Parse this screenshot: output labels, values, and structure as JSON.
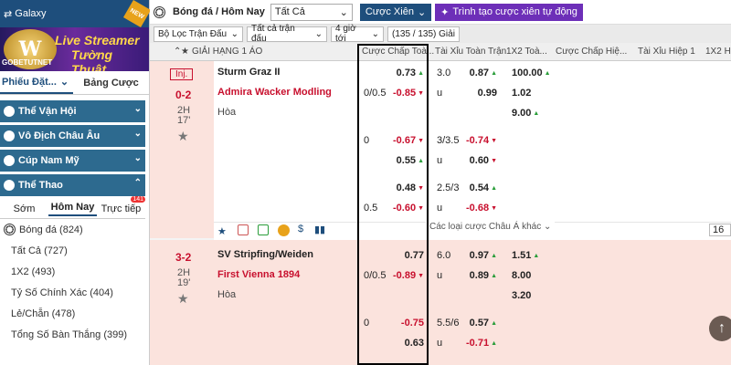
{
  "sidebar": {
    "galaxy": "Galaxy",
    "new_badge": "NEW",
    "banner_line1": "Live Streamer",
    "banner_line2": "Tường Thuật",
    "banner_brand": "GOBETUTNET",
    "tab_phieu": "Phiếu Đặt...",
    "tab_bang": "Bảng Cược",
    "menu": [
      "Thể Vận Hội",
      "Vô Địch Châu Âu",
      "Cúp Nam Mỹ",
      "Thể Thao"
    ],
    "subtabs": [
      "Sớm",
      "Hôm Nay",
      "Trực tiếp"
    ],
    "live_count": "141",
    "sport": "Bóng đá (824)",
    "items": [
      "Tất Cả (727)",
      "1X2 (493)",
      "Tỷ Số Chính Xác (404)",
      "Lẻ/Chẵn (478)",
      "Tổng Số Bàn Thắng (399)"
    ]
  },
  "topbar": {
    "title": "Bóng đá / Hôm Nay",
    "select": "Tất Cả",
    "cuoc_xien": "Cược Xiên",
    "tao_cuoc": "Trình tạo cược xiên tự động"
  },
  "filters": {
    "loc": "Bộ Lọc Trận Đấu",
    "tat_ca": "Tất cả trận đấu",
    "gio": "4 giờ tới",
    "count": "(135 / 135) Giải"
  },
  "header": {
    "league": "GIẢI HẠNG 1 ÁO",
    "c1": "Cược Chấp Toà...",
    "c2": "Tài Xỉu Toàn Trận",
    "c3": "1X2 Toà...",
    "c4": "Cược Chấp Hiệ...",
    "c5": "Tài Xỉu Hiệp 1",
    "c6": "1X2 Hi"
  },
  "match1": {
    "status": "Inj.",
    "score": "0-2",
    "period": "2H",
    "minute": "17'",
    "home": "Sturm Graz II",
    "away": "Admira Wacker Modling",
    "draw": "Hòa"
  },
  "match2": {
    "score": "3-2",
    "period": "2H",
    "minute": "19'",
    "home": "SV Stripfing/Weiden",
    "away": "First Vienna 1894",
    "draw": "Hòa"
  },
  "m1_rows": [
    {
      "hcap": "",
      "hval": "0.73",
      "ou": "3.0",
      "ouv": "0.87",
      "x12": "100.00"
    },
    {
      "hcap": "0/0.5",
      "hval": "-0.85",
      "ou": "u",
      "ouv": "0.99",
      "x12": "1.02"
    },
    {
      "hcap": "",
      "hval": "",
      "ou": "",
      "ouv": "",
      "x12": "9.00"
    },
    {
      "hcap": "0",
      "hval": "-0.67",
      "ou": "3/3.5",
      "ouv": "-0.74",
      "x12": ""
    },
    {
      "hcap": "",
      "hval": "0.55",
      "ou": "u",
      "ouv": "0.60",
      "x12": ""
    },
    {
      "hcap": "",
      "hval": "0.48",
      "ou": "2.5/3",
      "ouv": "0.54",
      "x12": ""
    },
    {
      "hcap": "0.5",
      "hval": "-0.60",
      "ou": "u",
      "ouv": "-0.68",
      "x12": ""
    }
  ],
  "m2_rows": [
    {
      "hcap": "",
      "hval": "0.77",
      "ou": "6.0",
      "ouv": "0.97",
      "x12": "1.51"
    },
    {
      "hcap": "0/0.5",
      "hval": "-0.89",
      "ou": "u",
      "ouv": "0.89",
      "x12": "8.00"
    },
    {
      "hcap": "",
      "hval": "",
      "ou": "",
      "ouv": "",
      "x12": "3.20"
    },
    {
      "hcap": "0",
      "hval": "-0.75",
      "ou": "5.5/6",
      "ouv": "0.57",
      "x12": ""
    },
    {
      "hcap": "",
      "hval": "0.63",
      "ou": "u",
      "ouv": "-0.71",
      "x12": ""
    }
  ],
  "more_bets": "Các loại cược Châu Á khác",
  "page_num": "16"
}
